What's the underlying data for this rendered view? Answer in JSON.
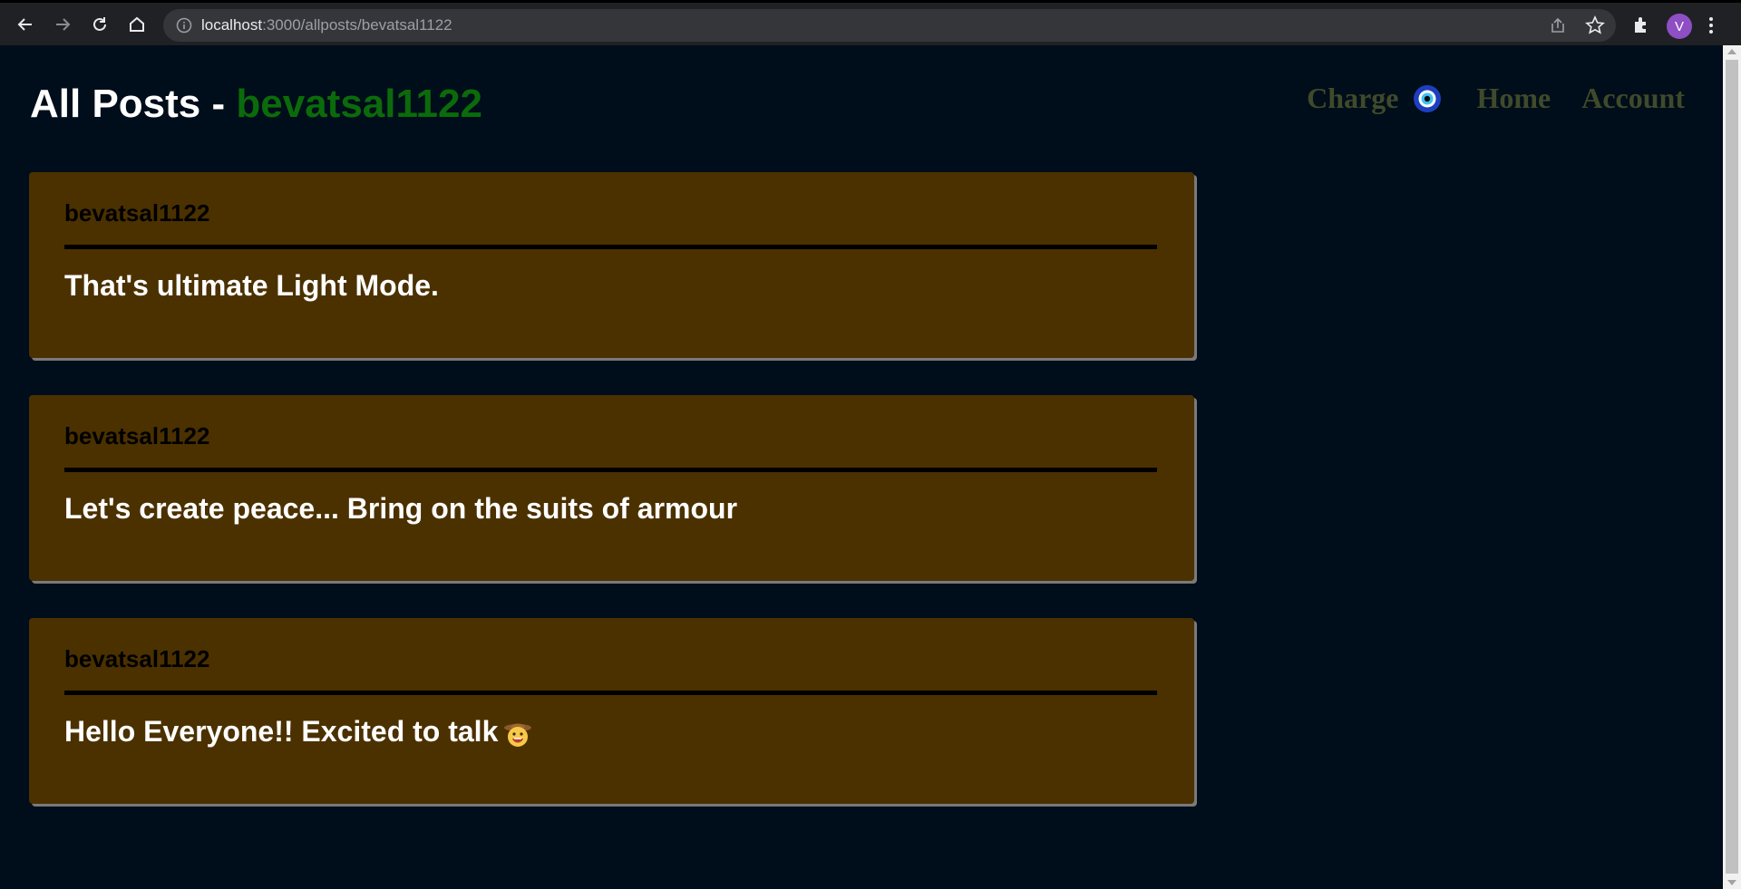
{
  "browser": {
    "url_host": "localhost",
    "url_rest": ":3000/allposts/bevatsal1122",
    "avatar_letter": "V",
    "avatar_color": "#8e4fc4"
  },
  "header": {
    "title_prefix": "All Posts - ",
    "title_username": "bevatsal1122",
    "username_color": "#0b6b0b"
  },
  "nav": {
    "charge_label": "Charge",
    "charge_icon": "nazar-eye-icon",
    "home_label": "Home",
    "account_label": "Account",
    "link_color": "#3f4a2a"
  },
  "posts": [
    {
      "author": "bevatsal1122",
      "content": "That's ultimate Light Mode."
    },
    {
      "author": "bevatsal1122",
      "content": "Let's create peace... Bring on the suits of armour"
    },
    {
      "author": "bevatsal1122",
      "content": "Hello Everyone!! Excited to talk",
      "emoji": "cowboy-face-icon"
    }
  ],
  "colors": {
    "background": "#000d1a",
    "post_background": "#4b3100",
    "post_text": "#ffffff",
    "author_text": "#000000"
  }
}
